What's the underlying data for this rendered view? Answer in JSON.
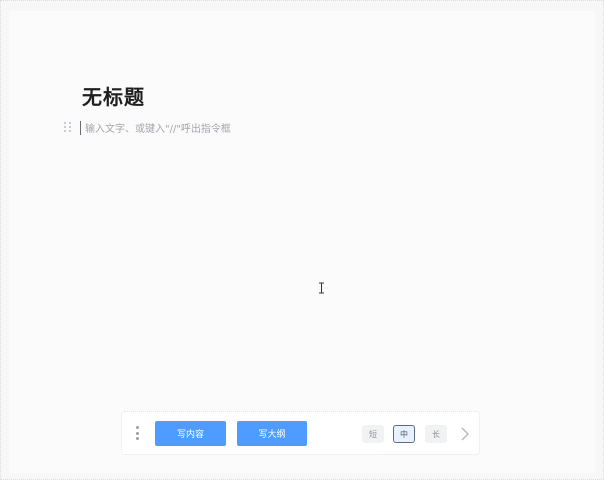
{
  "document": {
    "title": "无标题",
    "body_placeholder": "输入文字、或键入\"//\"呼出指令框"
  },
  "toolbar": {
    "write_content_label": "写内容",
    "write_outline_label": "写大纲",
    "length_options": [
      {
        "label": "短",
        "selected": false
      },
      {
        "label": "中",
        "selected": true
      },
      {
        "label": "长",
        "selected": false
      }
    ]
  },
  "colors": {
    "primary": "#4e9cff",
    "title_text": "#1f1f1f",
    "placeholder_text": "#a3a6ad"
  },
  "icons": {
    "drag_handle": "drag-handle-icon",
    "text_cursor": "text-cursor-icon",
    "more": "more-vertical-icon",
    "next": "chevron-right-icon"
  }
}
